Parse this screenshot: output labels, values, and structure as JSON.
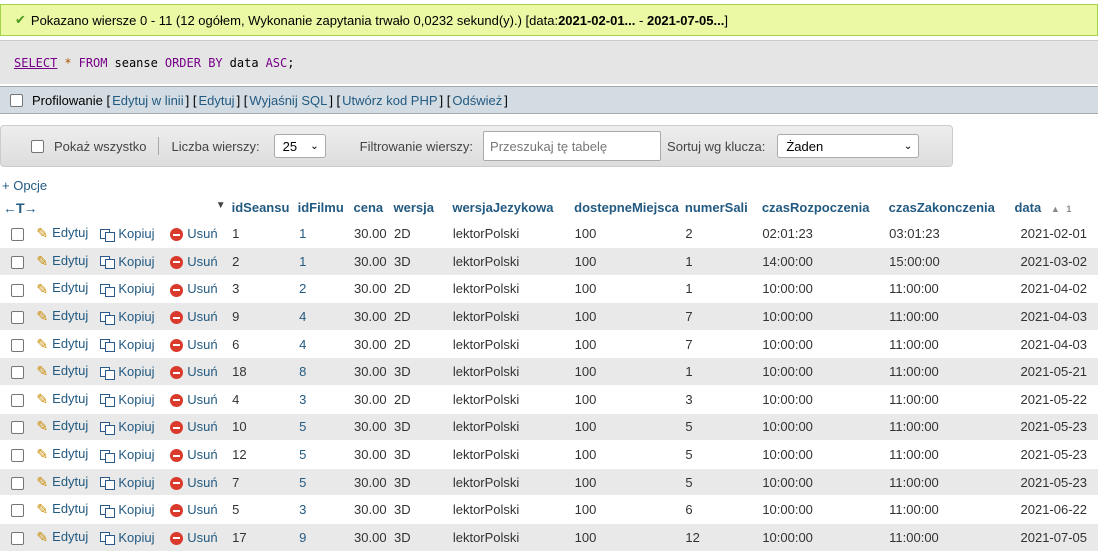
{
  "success": {
    "prefix": "Pokazano wiersze 0 - 11 (12 ogółem, Wykonanie zapytania trwało 0,0232 sekund(y).) [data: ",
    "range_from": "2021-02-01...",
    "range_sep": " - ",
    "range_to": "2021-07-05...",
    "suffix": "]"
  },
  "sql": {
    "select": "SELECT",
    "star": "*",
    "from": "FROM",
    "table": "seanse",
    "order_by": "ORDER BY",
    "column": "data",
    "asc": "ASC",
    "semicolon": ";"
  },
  "profiling": {
    "label": "Profilowanie",
    "links": [
      "Edytuj w linii",
      "Edytuj",
      "Wyjaśnij SQL",
      "Utwórz kod PHP",
      "Odśwież"
    ]
  },
  "navbar": {
    "show_all": "Pokaż wszystko",
    "rows_label": "Liczba wierszy:",
    "rows_value": "25",
    "filter_label": "Filtrowanie wierszy:",
    "filter_placeholder": "Przeszukaj tę tabelę",
    "sort_label": "Sortuj wg klucza:",
    "sort_value": "Żaden"
  },
  "options_link": "+ Opcje",
  "table": {
    "columns": [
      "idSeansu",
      "idFilmu",
      "cena",
      "wersja",
      "wersjaJezykowa",
      "dostepneMiejsca",
      "numerSali",
      "czasRozpoczenia",
      "czasZakonczenia",
      "data"
    ],
    "sort_indicator": "1",
    "actions": {
      "edit": "Edytuj",
      "copy": "Kopiuj",
      "delete": "Usuń"
    },
    "rows": [
      [
        "1",
        "1",
        "30.00",
        "2D",
        "lektorPolski",
        "100",
        "2",
        "02:01:23",
        "03:01:23",
        "2021-02-01"
      ],
      [
        "2",
        "1",
        "30.00",
        "3D",
        "lektorPolski",
        "100",
        "1",
        "14:00:00",
        "15:00:00",
        "2021-03-02"
      ],
      [
        "3",
        "2",
        "30.00",
        "2D",
        "lektorPolski",
        "100",
        "1",
        "10:00:00",
        "11:00:00",
        "2021-04-02"
      ],
      [
        "9",
        "4",
        "30.00",
        "2D",
        "lektorPolski",
        "100",
        "7",
        "10:00:00",
        "11:00:00",
        "2021-04-03"
      ],
      [
        "6",
        "4",
        "30.00",
        "2D",
        "lektorPolski",
        "100",
        "7",
        "10:00:00",
        "11:00:00",
        "2021-04-03"
      ],
      [
        "18",
        "8",
        "30.00",
        "3D",
        "lektorPolski",
        "100",
        "1",
        "10:00:00",
        "11:00:00",
        "2021-05-21"
      ],
      [
        "4",
        "3",
        "30.00",
        "2D",
        "lektorPolski",
        "100",
        "3",
        "10:00:00",
        "11:00:00",
        "2021-05-22"
      ],
      [
        "10",
        "5",
        "30.00",
        "3D",
        "lektorPolski",
        "100",
        "5",
        "10:00:00",
        "11:00:00",
        "2021-05-23"
      ],
      [
        "12",
        "5",
        "30.00",
        "3D",
        "lektorPolski",
        "100",
        "5",
        "10:00:00",
        "11:00:00",
        "2021-05-23"
      ],
      [
        "7",
        "5",
        "30.00",
        "3D",
        "lektorPolski",
        "100",
        "5",
        "10:00:00",
        "11:00:00",
        "2021-05-23"
      ],
      [
        "5",
        "3",
        "30.00",
        "3D",
        "lektorPolski",
        "100",
        "6",
        "10:00:00",
        "11:00:00",
        "2021-06-22"
      ],
      [
        "17",
        "9",
        "30.00",
        "3D",
        "lektorPolski",
        "100",
        "12",
        "10:00:00",
        "11:00:00",
        "2021-07-05"
      ]
    ]
  }
}
